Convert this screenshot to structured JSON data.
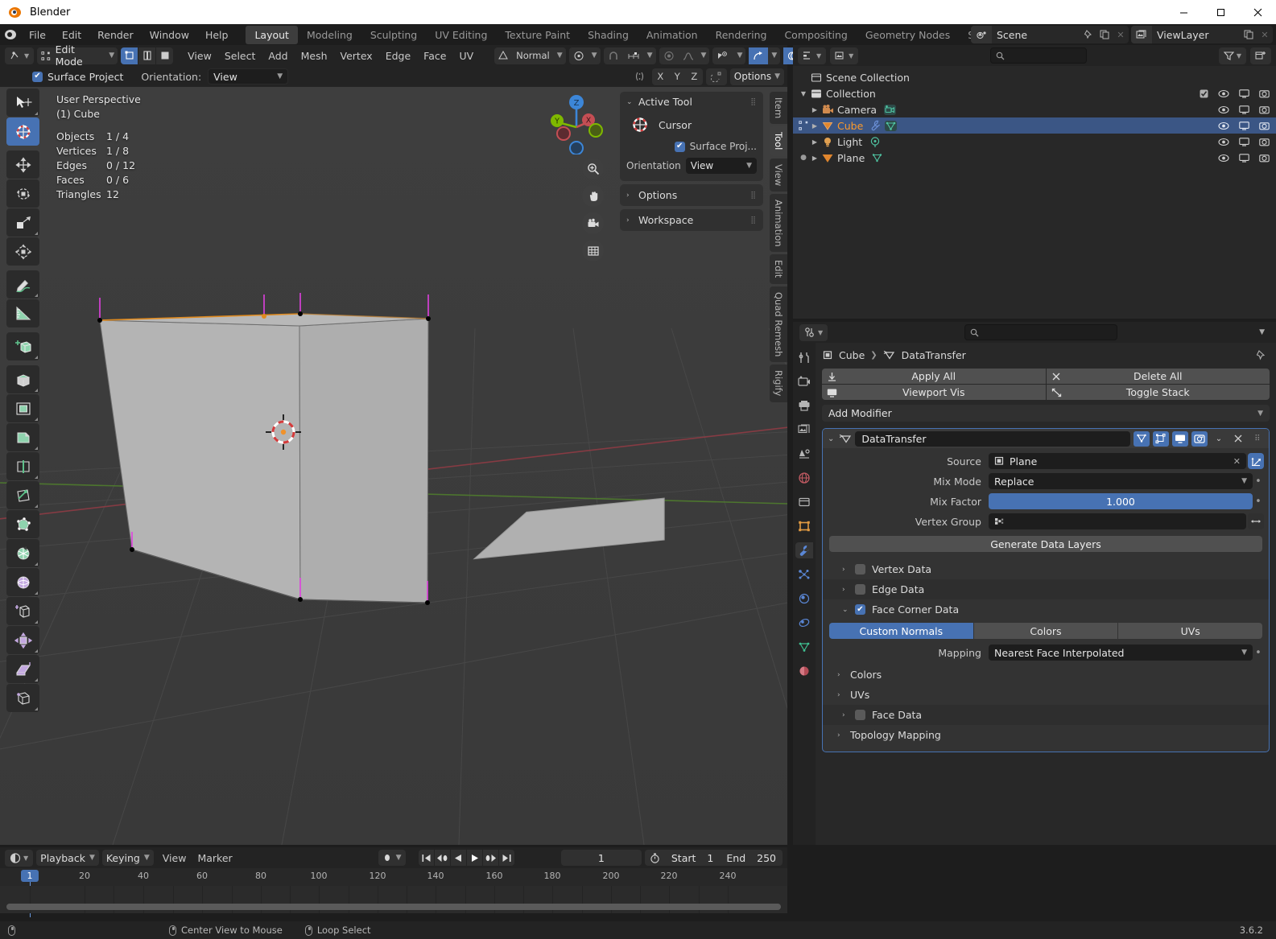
{
  "window": {
    "title": "Blender",
    "logo_icon": "blender-logo-icon",
    "minimize_label": "—",
    "maximize_label": "☐",
    "close_label": "✕"
  },
  "topbar": {
    "app_icon": "blender-icon",
    "menus": [
      "File",
      "Edit",
      "Render",
      "Window",
      "Help"
    ],
    "workspace_tabs": [
      {
        "label": "Layout",
        "active": true
      },
      {
        "label": "Modeling",
        "active": false
      },
      {
        "label": "Sculpting",
        "active": false
      },
      {
        "label": "UV Editing",
        "active": false
      },
      {
        "label": "Texture Paint",
        "active": false
      },
      {
        "label": "Shading",
        "active": false
      },
      {
        "label": "Animation",
        "active": false
      },
      {
        "label": "Rendering",
        "active": false
      },
      {
        "label": "Compositing",
        "active": false
      },
      {
        "label": "Geometry Nodes",
        "active": false
      },
      {
        "label": "Scripting",
        "active": false
      }
    ],
    "add_workspace_label": "+",
    "scene": {
      "icon": "scene-icon",
      "name": "Scene",
      "pin_icon": "pin-icon",
      "copy_icon": "duplicate-icon",
      "close_icon": "x-icon"
    },
    "viewlayer": {
      "icon": "viewlayer-icon",
      "name": "ViewLayer",
      "copy_icon": "duplicate-icon",
      "close_icon": "x-icon"
    }
  },
  "viewport_header": {
    "editor_type_icon": "editor-type-icon",
    "mode": "Edit Mode",
    "select_modes": [
      {
        "name": "vertex-select-icon",
        "active": true
      },
      {
        "name": "edge-select-icon",
        "active": false
      },
      {
        "name": "face-select-icon",
        "active": false
      }
    ],
    "menus": [
      "View",
      "Select",
      "Add",
      "Mesh",
      "Vertex",
      "Edge",
      "Face",
      "UV"
    ],
    "transform_orientation": "Normal",
    "pivot_icon": "pivot-point-icon",
    "snap_icon": "snap-magnet-icon",
    "snap_increment_icon": "snap-increment-icon",
    "proportional_icon": "proportional-editing-icon",
    "proportional_falloff_icon": "falloff-curve-icon",
    "visibility_icon": "object-visibility-icon",
    "xray_icon": "toggle-xray-icon",
    "gizmo_icon": "gizmo-icon",
    "overlays_icon": "overlays-icon",
    "shading_modes": [
      "wireframe-shading-icon",
      "solid-shading-icon"
    ]
  },
  "viewport_header_row2": {
    "surface_project_label": "Surface Project",
    "surface_project_checked": true,
    "orientation_label": "Orientation:",
    "orientation_value": "View",
    "mesh_select_icon": "mesh-symmetry-icon",
    "axis_buttons": [
      "X",
      "Y",
      "Z"
    ],
    "topology_mirror_icon": "topology-mirror-icon",
    "options_label": "Options"
  },
  "viewport": {
    "view_name": "User Perspective",
    "collection_object": "(1) Cube",
    "stats": [
      {
        "label": "Objects",
        "value": "1 / 4"
      },
      {
        "label": "Vertices",
        "value": "1 / 8"
      },
      {
        "label": "Edges",
        "value": "0 / 12"
      },
      {
        "label": "Faces",
        "value": "0 / 6"
      },
      {
        "label": "Triangles",
        "value": "12"
      }
    ],
    "gizmo_axes": [
      {
        "label": "Z",
        "color": "#3c86d8"
      },
      {
        "label": "X",
        "color": "#c44e54"
      },
      {
        "label": "Y",
        "color": "#7fb800"
      }
    ],
    "nav_buttons": [
      "zoom-icon",
      "pan-hand-icon",
      "camera-view-icon",
      "toggle-orthographic-icon"
    ],
    "toolbar_tools": [
      {
        "name": "tweak-tool",
        "active": false
      },
      {
        "name": "cursor-tool",
        "active": true
      },
      {
        "name": "move-tool",
        "active": false
      },
      {
        "name": "rotate-tool",
        "active": false
      },
      {
        "name": "scale-tool",
        "active": false
      },
      {
        "name": "transform-tool",
        "active": false
      },
      {
        "name": "annotate-tool",
        "active": false
      },
      {
        "name": "measure-tool",
        "active": false
      },
      {
        "name": "add-cube-tool",
        "active": false
      },
      {
        "name": "extrude-region-tool",
        "active": false
      },
      {
        "name": "inset-faces-tool",
        "active": false
      },
      {
        "name": "bevel-tool",
        "active": false
      },
      {
        "name": "loop-cut-tool",
        "active": false
      },
      {
        "name": "knife-tool",
        "active": false
      },
      {
        "name": "poly-build-tool",
        "active": false
      },
      {
        "name": "spin-tool",
        "active": false
      },
      {
        "name": "smooth-tool",
        "active": false
      },
      {
        "name": "edge-slide-tool",
        "active": false
      },
      {
        "name": "shrink-fatten-tool",
        "active": false
      },
      {
        "name": "shear-tool",
        "active": false
      },
      {
        "name": "rip-region-tool",
        "active": false
      }
    ],
    "cursor_3d_icon": "3d-cursor-icon"
  },
  "npanel": {
    "active_tool": {
      "title": "Active Tool",
      "tool_name": "Cursor",
      "tool_icon": "cursor-tool-icon",
      "surface_project_label": "Surface Proj...",
      "surface_project_checked": true,
      "orientation_label": "Orientation",
      "orientation_value": "View"
    },
    "options_label": "Options",
    "workspace_label": "Workspace",
    "tabs": [
      {
        "label": "Item",
        "active": false
      },
      {
        "label": "Tool",
        "active": true
      },
      {
        "label": "View",
        "active": false
      },
      {
        "label": "Animation",
        "active": false
      },
      {
        "label": "Edit",
        "active": false
      },
      {
        "label": "Quad Remesh",
        "active": false
      },
      {
        "label": "Rigify",
        "active": false
      }
    ]
  },
  "outliner": {
    "display_mode_icon": "outliner-display-mode-icon",
    "filter_collection_icon": "outliner-id-type-icon",
    "search_placeholder": "",
    "search_icon": "search-icon",
    "filter_icon": "filter-icon",
    "new_collection_icon": "new-collection-icon",
    "rows": [
      {
        "name": "Scene Collection",
        "icon": "scene-collection-icon",
        "indent": 0,
        "expand": "",
        "selected": false,
        "highlight": false,
        "data_icons": [],
        "toggles": []
      },
      {
        "name": "Collection",
        "icon": "collection-icon",
        "indent": 1,
        "expand": "▼",
        "selected": false,
        "highlight": false,
        "data_icons": [],
        "toggles": [
          "checkbox-checked-icon",
          "eye-icon",
          "screen-icon",
          "camera-icon"
        ]
      },
      {
        "name": "Camera",
        "icon": "camera-object-icon",
        "indent": 2,
        "expand": "▶",
        "selected": false,
        "highlight": false,
        "data_icons": [
          "camera-data-icon"
        ],
        "toggles": [
          "eye-icon",
          "screen-icon",
          "camera-icon"
        ]
      },
      {
        "name": "Cube",
        "icon": "mesh-object-icon",
        "indent": 2,
        "expand": "▶",
        "selected": true,
        "highlight": true,
        "data_icons": [
          "modifier-wrench-icon",
          "mesh-data-icon"
        ],
        "toggles": [
          "eye-icon",
          "screen-icon",
          "camera-icon"
        ]
      },
      {
        "name": "Light",
        "icon": "light-object-icon",
        "indent": 2,
        "expand": "▶",
        "selected": false,
        "highlight": false,
        "data_icons": [
          "light-data-icon"
        ],
        "toggles": [
          "eye-icon",
          "screen-icon",
          "camera-icon"
        ]
      },
      {
        "name": "Plane",
        "icon": "mesh-object-icon",
        "indent": 2,
        "expand": "▶",
        "selected": false,
        "highlight": false,
        "data_icons": [
          "mesh-data-icon"
        ],
        "toggles": [
          "eye-icon",
          "screen-icon",
          "camera-icon"
        ]
      }
    ]
  },
  "properties": {
    "editor_type_icon": "properties-editor-icon",
    "search_placeholder": "",
    "search_icon": "search-icon",
    "expand_icon": "chevron-down-icon",
    "breadcrumb": [
      {
        "label": "Cube",
        "icon": "object-icon"
      },
      {
        "label": "DataTransfer",
        "icon": "modifier-datatransfer-icon"
      }
    ],
    "pin_icon": "pin-icon",
    "tabs": [
      {
        "name": "tool-tab",
        "icon": "tool-icon",
        "active": false
      },
      {
        "name": "render-tab",
        "icon": "render-camera-icon",
        "active": false
      },
      {
        "name": "output-tab",
        "icon": "printer-icon",
        "active": false
      },
      {
        "name": "viewlayer-tab",
        "icon": "images-icon",
        "active": false
      },
      {
        "name": "scene-tab",
        "icon": "scene-cone-icon",
        "active": false
      },
      {
        "name": "world-tab",
        "icon": "world-globe-icon",
        "active": false
      },
      {
        "name": "collection-tab",
        "icon": "collection-box-icon",
        "active": false
      },
      {
        "name": "object-tab",
        "icon": "object-square-icon",
        "active": false
      },
      {
        "name": "modifier-tab",
        "icon": "wrench-icon",
        "active": true
      },
      {
        "name": "particles-tab",
        "icon": "particles-icon",
        "active": false
      },
      {
        "name": "physics-tab",
        "icon": "physics-orbit-icon",
        "active": false
      },
      {
        "name": "constraints-tab",
        "icon": "constraint-icon",
        "active": false
      },
      {
        "name": "data-tab",
        "icon": "mesh-data-green-icon",
        "active": false
      },
      {
        "name": "material-tab",
        "icon": "material-sphere-icon",
        "active": false
      }
    ],
    "stack_buttons": [
      {
        "label": "Apply All",
        "icon": "apply-icon"
      },
      {
        "label": "Delete All",
        "icon": "x-icon"
      },
      {
        "label": "Viewport Vis",
        "icon": "screen-icon"
      },
      {
        "label": "Toggle Stack",
        "icon": "expand-icon"
      }
    ],
    "add_modifier_label": "Add Modifier",
    "modifier": {
      "expand_icon": "chevron-down-icon",
      "type_icon": "modifier-datatransfer-icon",
      "name": "DataTransfer",
      "header_toggles": [
        {
          "name": "edit-mode-display-icon",
          "active": true
        },
        {
          "name": "on-cage-icon",
          "active": true
        },
        {
          "name": "realtime-display-icon",
          "active": true
        },
        {
          "name": "render-display-icon",
          "active": true
        }
      ],
      "dropdown_icon": "chevron-down-icon",
      "delete_icon": "x-icon",
      "drag_icon": "drag-handle-icon",
      "fields": [
        {
          "label": "Source",
          "value": "Plane",
          "type": "object",
          "icon": "object-icon",
          "clear_icon": "x-icon",
          "extra_icon": "object-transform-icon"
        },
        {
          "label": "Mix Mode",
          "value": "Replace",
          "type": "dropdown",
          "animate_dot": true
        },
        {
          "label": "Mix Factor",
          "value": "1.000",
          "type": "slider",
          "animate_dot": true
        },
        {
          "label": "Vertex Group",
          "value": "",
          "type": "vertexgroup",
          "icon": "vertex-group-icon",
          "invert_icon": "invert-arrows-icon"
        }
      ],
      "generate_button_label": "Generate Data Layers",
      "sections": [
        {
          "label": "Vertex Data",
          "arrow": "›",
          "checkbox": true,
          "checked": false,
          "shaded": false
        },
        {
          "label": "Edge Data",
          "arrow": "›",
          "checkbox": true,
          "checked": false,
          "shaded": true
        },
        {
          "label": "Face Corner Data",
          "arrow": "⌄",
          "checkbox": true,
          "checked": true,
          "shaded": false
        }
      ],
      "face_corner_types": [
        {
          "label": "Custom Normals",
          "active": true
        },
        {
          "label": "Colors",
          "active": false
        },
        {
          "label": "UVs",
          "active": false
        }
      ],
      "mapping_label": "Mapping",
      "mapping_value": "Nearest Face Interpolated",
      "subsections": [
        {
          "label": "Colors",
          "arrow": "›",
          "checkbox": false,
          "checked": false,
          "shaded": false
        },
        {
          "label": "UVs",
          "arrow": "›",
          "checkbox": false,
          "checked": false,
          "shaded": false
        },
        {
          "label": "Face Data",
          "arrow": "›",
          "checkbox": true,
          "checked": false,
          "shaded": true
        },
        {
          "label": "Topology Mapping",
          "arrow": "›",
          "checkbox": false,
          "checked": false,
          "shaded": false
        }
      ]
    }
  },
  "timeline": {
    "editor_type_icon": "timeline-editor-icon",
    "menus_dropdown": [
      "Playback",
      "Keying"
    ],
    "menus": [
      "View",
      "Marker"
    ],
    "keyframe_type_icon": "keyframe-type-icon",
    "playback_buttons": [
      "jump-start-icon",
      "prev-keyframe-icon",
      "play-reverse-icon",
      "play-icon",
      "next-keyframe-icon",
      "jump-end-icon"
    ],
    "current_frame": "1",
    "autokey_icon": "auto-keying-icon",
    "start_label": "Start",
    "start_value": "1",
    "end_label": "End",
    "end_value": "250",
    "ruler_ticks": [
      "20",
      "40",
      "60",
      "80",
      "100",
      "120",
      "140",
      "160",
      "180",
      "200",
      "220",
      "240"
    ],
    "playhead_frame": "1"
  },
  "statusbar": {
    "items": [
      {
        "icon": "mouse-icon",
        "label": ""
      },
      {
        "icon": "mouse-icon",
        "label": "Center View to Mouse"
      },
      {
        "icon": "mouse-icon",
        "label": "Loop Select"
      }
    ],
    "version": "3.6.2"
  },
  "colors": {
    "accent_blue": "#4772b3",
    "orange": "#fb9a2b",
    "panel_bg": "#282828",
    "header_bg": "#232323",
    "viewport_bg": "#3c3c3c"
  }
}
